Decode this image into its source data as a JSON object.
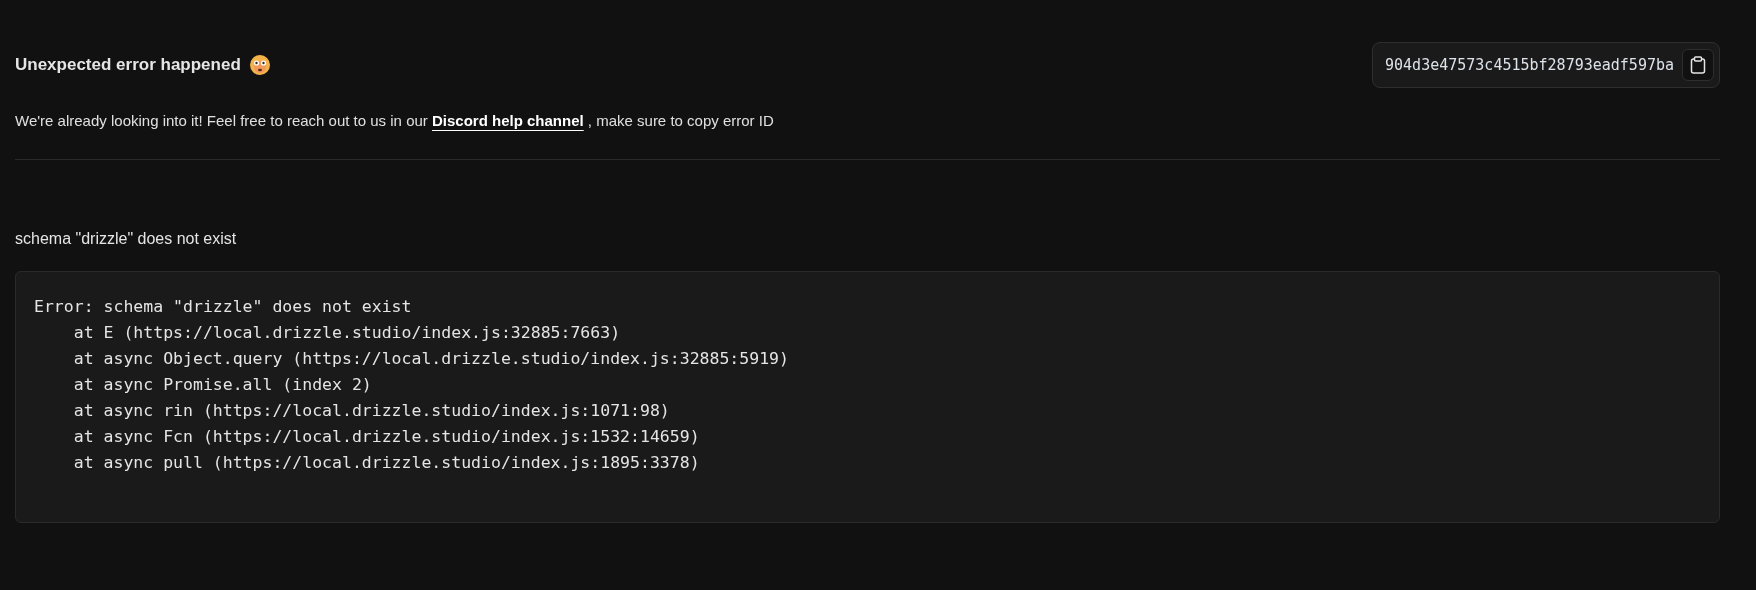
{
  "header": {
    "title": "Unexpected error happened",
    "error_id": "904d3e47573c4515bf28793eadf597ba"
  },
  "message": {
    "before": "We're already looking into it! Feel free to reach out to us in our",
    "link": "Discord help channel",
    "after": ", make sure to copy error ID"
  },
  "error_summary": "schema \"drizzle\" does not exist",
  "stack_trace": [
    "Error: schema \"drizzle\" does not exist",
    "    at E (https://local.drizzle.studio/index.js:32885:7663)",
    "    at async Object.query (https://local.drizzle.studio/index.js:32885:5919)",
    "    at async Promise.all (index 2)",
    "    at async rin (https://local.drizzle.studio/index.js:1071:98)",
    "    at async Fcn (https://local.drizzle.studio/index.js:1532:14659)",
    "    at async pull (https://local.drizzle.studio/index.js:1895:3378)"
  ]
}
